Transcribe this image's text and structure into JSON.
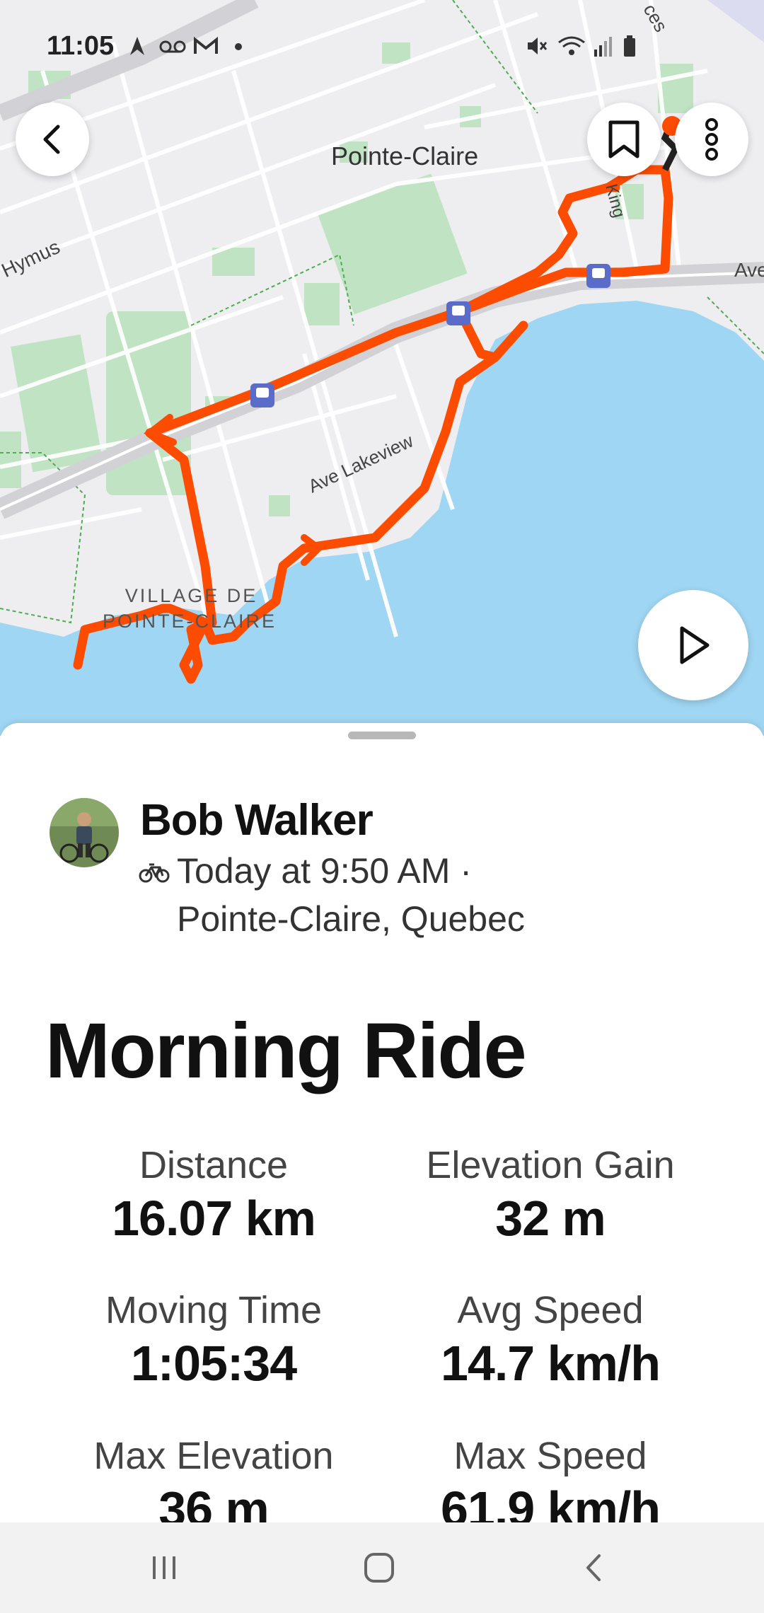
{
  "status_bar": {
    "time": "11:05",
    "left_icons": [
      "navigation-arrow-icon",
      "voicemail-icon",
      "gmail-icon",
      "dot-icon"
    ],
    "right_icons": [
      "mute-icon",
      "wifi-icon",
      "signal-icon",
      "battery-icon"
    ]
  },
  "map": {
    "labels": {
      "pointe_claire": "Pointe-Claire",
      "hymus": "Hymus",
      "king": "King",
      "ave": "Ave",
      "ave_lakeview": "Ave Lakeview",
      "ces": "ces",
      "village_line1": "VILLAGE DE",
      "village_line2": "POINTE-CLAIRE"
    },
    "route_color": "#fc4c02",
    "water_color": "#9fd6f3"
  },
  "buttons": {
    "back": "back-arrow-icon",
    "bookmark": "bookmark-icon",
    "more": "more-vertical-icon",
    "play": "play-icon"
  },
  "activity": {
    "athlete_name": "Bob Walker",
    "sport_icon": "bike-icon",
    "time": "Today at 9:50 AM ·",
    "location": "Pointe-Claire, Quebec",
    "title": "Morning Ride"
  },
  "stats": [
    {
      "label": "Distance",
      "value": "16.07 km"
    },
    {
      "label": "Elevation Gain",
      "value": "32 m"
    },
    {
      "label": "Moving Time",
      "value": "1:05:34"
    },
    {
      "label": "Avg Speed",
      "value": "14.7 km/h"
    },
    {
      "label": "Max Elevation",
      "value": "36 m"
    },
    {
      "label": "Max Speed",
      "value": "61.9 km/h"
    }
  ],
  "nav": [
    "recent-apps-icon",
    "home-icon",
    "back-icon"
  ]
}
